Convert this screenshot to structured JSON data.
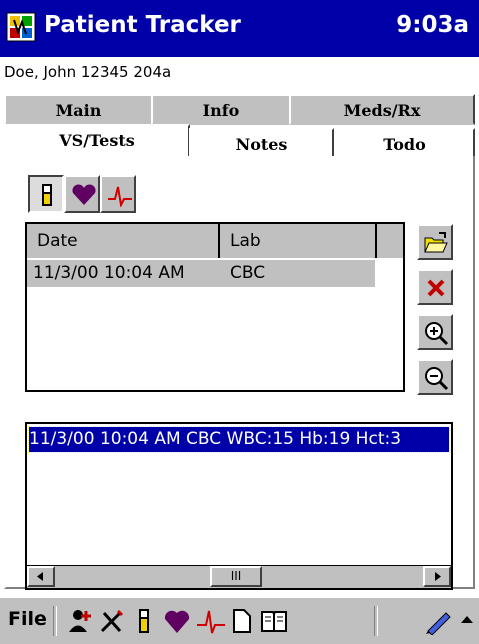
{
  "titlebar": {
    "title": "Patient Tracker",
    "time": "9:03a"
  },
  "patient": {
    "label": "Doe, John 12345 204a"
  },
  "tabs": {
    "row1": [
      "Main",
      "Info",
      "Meds/Rx"
    ],
    "row2": [
      "VS/Tests",
      "Notes",
      "Todo"
    ],
    "selected": "VS/Tests"
  },
  "test_type_buttons": [
    {
      "name": "lab-test-tube-icon",
      "selected": true
    },
    {
      "name": "heart-icon",
      "selected": false
    },
    {
      "name": "ecg-icon",
      "selected": false
    }
  ],
  "list": {
    "columns": [
      "Date",
      "Lab"
    ],
    "rows": [
      {
        "date": "11/3/00 10:04 AM",
        "lab": "CBC"
      }
    ]
  },
  "side_buttons": [
    "open-folder-icon",
    "delete-x-icon",
    "zoom-in-icon",
    "zoom-out-icon"
  ],
  "detail": {
    "text": "11/3/00 10:04 AM CBC WBC:15 Hb:19 Hct:3"
  },
  "scrollbar": {
    "thumb_label": "III"
  },
  "command_bar": {
    "file_label": "File",
    "icons": [
      "patient-add-icon",
      "procedure-icon",
      "test-tube-icon",
      "heart-icon",
      "ecg-icon",
      "document-icon",
      "book-icon",
      "pen-icon",
      "up-arrow-icon"
    ]
  },
  "colors": {
    "titlebar": "#0000a8",
    "selection": "#0000a8",
    "chrome": "#c0c0c0"
  }
}
